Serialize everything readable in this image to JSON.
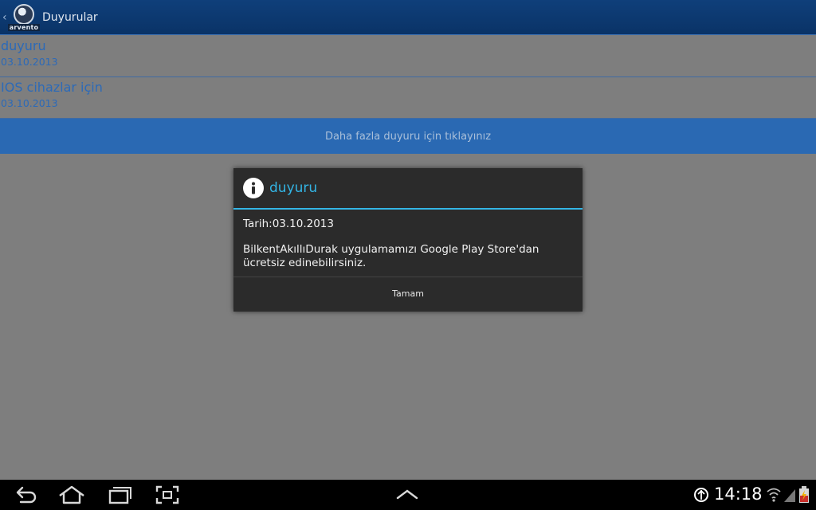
{
  "action_bar": {
    "logo_text": "arvento",
    "title": "Duyurular"
  },
  "list": {
    "items": [
      {
        "title": "duyuru",
        "date": "03.10.2013"
      },
      {
        "title": "IOS cihazlar için",
        "date": "03.10.2013"
      }
    ],
    "more_label": "Daha fazla duyuru için tıklayınız"
  },
  "dialog": {
    "icon": "info-icon",
    "title": "duyuru",
    "date_line": "Tarih:03.10.2013",
    "message": "BilkentAkıllıDurak uygulamamızı Google Play Store'dan ücretsiz edinebilirsiniz.",
    "ok_label": "Tamam"
  },
  "system_bar": {
    "buttons": [
      "back-icon",
      "home-icon",
      "recent-apps-icon",
      "screenshot-icon",
      "expand-up-icon"
    ],
    "clock": "14:18",
    "status_icons": [
      "usb-debug-icon",
      "wifi-icon",
      "signal-icon",
      "battery-icon"
    ]
  },
  "colors": {
    "action_bar": "#0f3f7a",
    "list_text": "#2c6ab8",
    "more_bar": "#2a69b3",
    "dialog_accent": "#33b5e5",
    "dim_background": "#7e7e7e"
  }
}
